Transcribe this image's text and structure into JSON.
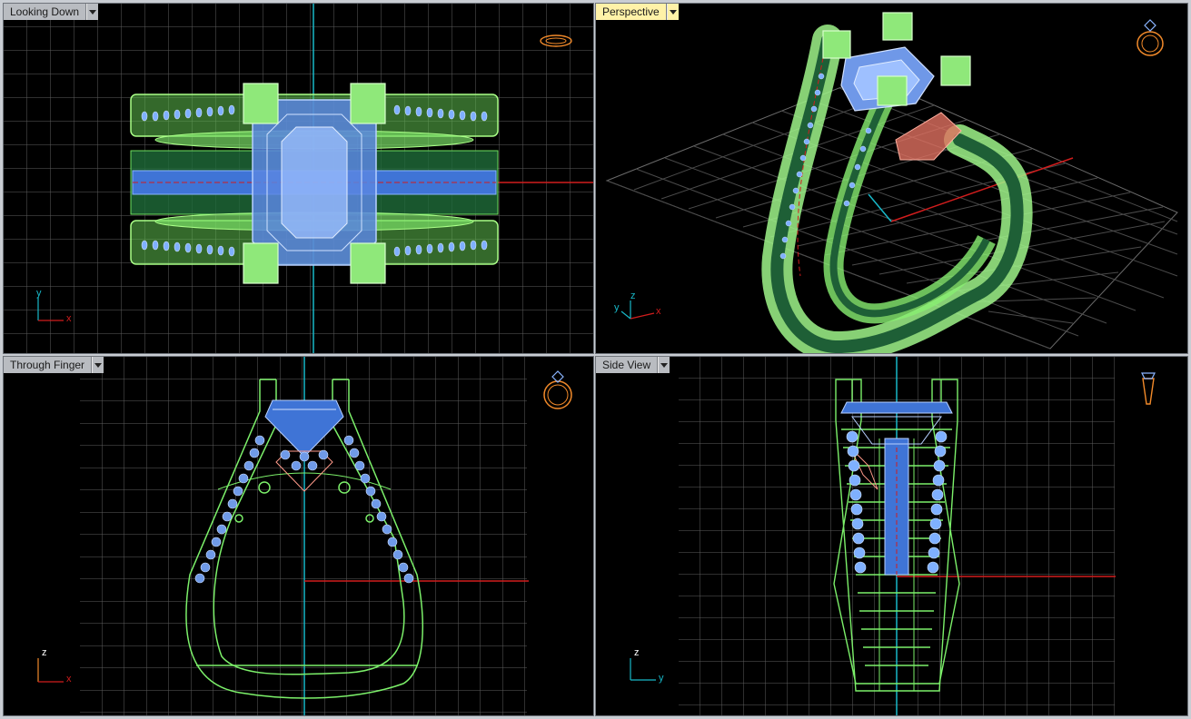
{
  "viewports": {
    "top_left": {
      "label": "Looking Down",
      "axis_h": "x",
      "axis_v": "y",
      "active": false
    },
    "top_right": {
      "label": "Perspective",
      "axis_a": "z",
      "axis_b": "x",
      "axis_c": "y",
      "active": true
    },
    "bottom_left": {
      "label": "Through Finger",
      "axis_h": "x",
      "axis_v": "z",
      "active": false
    },
    "bottom_right": {
      "label": "Side View",
      "axis_h": "y",
      "axis_v": "z",
      "active": false
    }
  },
  "icons": {
    "dropdown": "chevron-down-icon",
    "nav_widget": "ring-nav-icon"
  },
  "colors": {
    "viewport_bg": "#000000",
    "grid": "#7a7a7a",
    "model_wire": "#7cf06a",
    "model_fill": "#2f8a3a",
    "gem_wire": "#8ab4ff",
    "gem_fill": "#4a78d8",
    "seat_wire": "#ff9a8a",
    "axis_x": "#d11d1d",
    "axis_y": "#18b8c8",
    "active_tab": "#fff2a8",
    "nav_icon": "#f28a2a"
  }
}
